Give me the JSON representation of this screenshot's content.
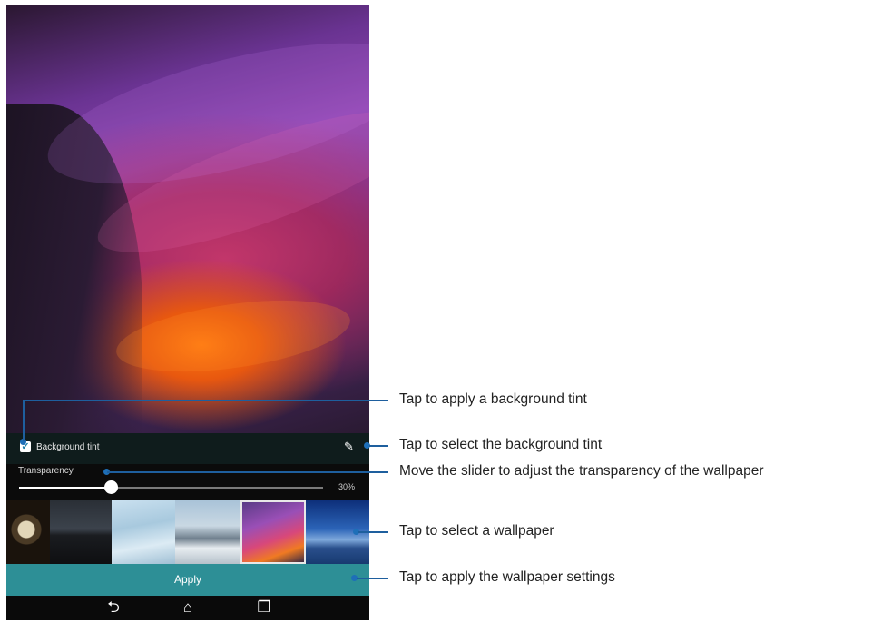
{
  "screen": {
    "background_tint_label": "Background tint",
    "background_tint_checked": true,
    "transparency_label": "Transparency",
    "transparency_value": 30,
    "transparency_text": "30%",
    "apply_label": "Apply",
    "icons": {
      "checkbox": "checkmark-icon",
      "tint_picker": "pencil-icon",
      "back": "back-arrow-icon",
      "home": "home-icon",
      "recents": "recent-apps-icon"
    },
    "glyphs": {
      "check": "✓",
      "pencil": "✎",
      "back": "⮌",
      "home": "⌂",
      "recents": "❐"
    },
    "thumbnails": [
      {
        "name": "wallpaper-thumb-clock",
        "selected": false
      },
      {
        "name": "wallpaper-thumb-mountain-night",
        "selected": false
      },
      {
        "name": "wallpaper-thumb-snow-dunes",
        "selected": false
      },
      {
        "name": "wallpaper-thumb-snowy-peaks",
        "selected": false
      },
      {
        "name": "wallpaper-thumb-purple-rock",
        "selected": true
      },
      {
        "name": "wallpaper-thumb-blue-sky",
        "selected": false
      }
    ],
    "colors": {
      "accent": "#2d8f96",
      "callout": "#1e6fb8"
    }
  },
  "callouts": [
    "Tap to apply a background tint",
    "Tap to select the background tint",
    "Move the slider to adjust the transparency of the wallpaper",
    "Tap to select a wallpaper",
    "Tap to apply the wallpaper settings"
  ]
}
